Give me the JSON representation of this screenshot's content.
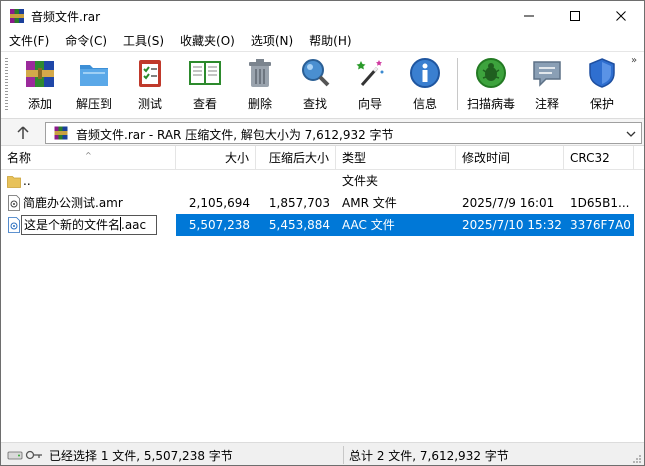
{
  "window": {
    "title": "音频文件.rar"
  },
  "menu": [
    {
      "label": "文件(F)"
    },
    {
      "label": "命令(C)"
    },
    {
      "label": "工具(S)"
    },
    {
      "label": "收藏夹(O)"
    },
    {
      "label": "选项(N)"
    },
    {
      "label": "帮助(H)"
    }
  ],
  "toolbar": {
    "buttons": [
      {
        "label": "添加",
        "icon": "add-books-icon"
      },
      {
        "label": "解压到",
        "icon": "extract-folder-icon"
      },
      {
        "label": "测试",
        "icon": "test-checklist-icon"
      },
      {
        "label": "查看",
        "icon": "view-book-icon"
      },
      {
        "label": "删除",
        "icon": "delete-trash-icon"
      },
      {
        "label": "查找",
        "icon": "find-magnifier-icon"
      },
      {
        "label": "向导",
        "icon": "wizard-wand-icon"
      },
      {
        "label": "信息",
        "icon": "info-icon"
      },
      {
        "label": "扫描病毒",
        "icon": "virus-scan-icon"
      },
      {
        "label": "注释",
        "icon": "comment-icon"
      },
      {
        "label": "保护",
        "icon": "protect-shield-icon"
      }
    ],
    "more": "»"
  },
  "address": {
    "text": "音频文件.rar - RAR 压缩文件, 解包大小为 7,612,932 字节"
  },
  "columns": {
    "name": "名称",
    "size": "大小",
    "packed": "压缩后大小",
    "type": "类型",
    "modified": "修改时间",
    "crc": "CRC32"
  },
  "rows": [
    {
      "name": "..",
      "size": "",
      "packed": "",
      "type": "文件夹",
      "modified": "",
      "crc": ""
    },
    {
      "name": "简鹿办公测试.amr",
      "size": "2,105,694",
      "packed": "1,857,703",
      "type": "AMR 文件",
      "modified": "2025/7/9 16:01",
      "crc": "1D65B1..."
    },
    {
      "name": "",
      "rename_value": "这是个新的文件名.aac",
      "size": "5,507,238",
      "packed": "5,453,884",
      "type": "AAC 文件",
      "modified": "2025/7/10 15:32",
      "crc": "3376F7A0"
    }
  ],
  "status": {
    "left": "已经选择 1 文件, 5,507,238 字节",
    "right": "总计 2 文件, 7,612,932 字节"
  },
  "colors": {
    "selection": "#0078d7"
  }
}
